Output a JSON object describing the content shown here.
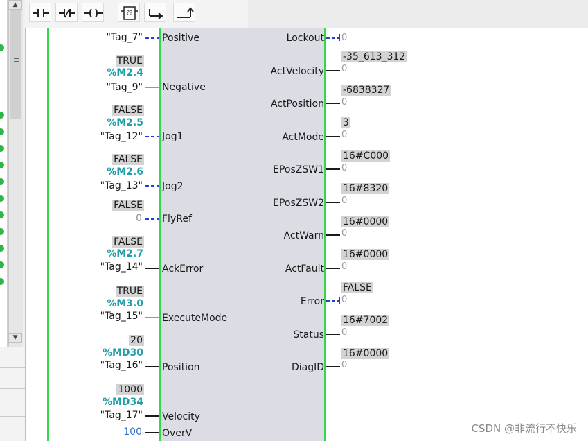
{
  "toolbar": {
    "buttons": [
      {
        "name": "normally-open-contact-icon"
      },
      {
        "name": "normally-closed-contact-icon"
      },
      {
        "name": "output-coil-icon"
      },
      {
        "name": "empty-box-icon",
        "label": "??"
      },
      {
        "name": "open-branch-icon"
      },
      {
        "name": "close-branch-icon"
      }
    ]
  },
  "inputs": {
    "positive": {
      "tag": "\"Tag_7\"",
      "pin": "Positive"
    },
    "negative": {
      "value": "TRUE",
      "address": "%M2.4",
      "tag": "\"Tag_9\"",
      "pin": "Negative"
    },
    "jog1": {
      "value": "FALSE",
      "address": "%M2.5",
      "tag": "\"Tag_12\"",
      "pin": "Jog1"
    },
    "jog2": {
      "value": "FALSE",
      "address": "%M2.6",
      "tag": "\"Tag_13\"",
      "pin": "Jog2"
    },
    "flyref": {
      "value": "FALSE",
      "constant": "0",
      "pin": "FlyRef"
    },
    "ackerror": {
      "value": "FALSE",
      "address": "%M2.7",
      "tag": "\"Tag_14\"",
      "pin": "AckError"
    },
    "executemode": {
      "value": "TRUE",
      "address": "%M3.0",
      "tag": "\"Tag_15\"",
      "pin": "ExecuteMode"
    },
    "position": {
      "value": "20",
      "address": "%MD30",
      "tag": "\"Tag_16\"",
      "pin": "Position"
    },
    "velocity": {
      "value": "1000",
      "address": "%MD34",
      "tag": "\"Tag_17\"",
      "pin": "Velocity"
    },
    "overv": {
      "constant": "100",
      "pin": "OverV"
    }
  },
  "outputs": {
    "lockout": {
      "pin": "Lockout",
      "zero": "0"
    },
    "actvelocity": {
      "value": "-35_613_312",
      "pin": "ActVelocity",
      "zero": "0"
    },
    "actposition": {
      "value": "-6838327",
      "pin": "ActPosition",
      "zero": "0"
    },
    "actmode": {
      "value": "3",
      "pin": "ActMode",
      "zero": "0"
    },
    "eposzsw1": {
      "value": "16#C000",
      "pin": "EPosZSW1",
      "zero": "0"
    },
    "eposzsw2": {
      "value": "16#8320",
      "pin": "EPosZSW2",
      "zero": "0"
    },
    "actwarn": {
      "value": "16#0000",
      "pin": "ActWarn",
      "zero": "0"
    },
    "actfault": {
      "value": "16#0000",
      "pin": "ActFault",
      "zero": "0"
    },
    "error": {
      "value": "FALSE",
      "pin": "Error",
      "zero": "0"
    },
    "status": {
      "value": "16#7002",
      "pin": "Status",
      "zero": "0"
    },
    "diagid": {
      "value": "16#0000",
      "pin": "DiagID",
      "zero": "0"
    }
  },
  "watermark": "CSDN @非流行不快乐",
  "colors": {
    "power_flow": "#34d64a",
    "address": "#1e9ea8",
    "block_body": "#dcdce4",
    "value_box": "#d3d3d3",
    "dashed_blue": "#1f3fd6"
  }
}
